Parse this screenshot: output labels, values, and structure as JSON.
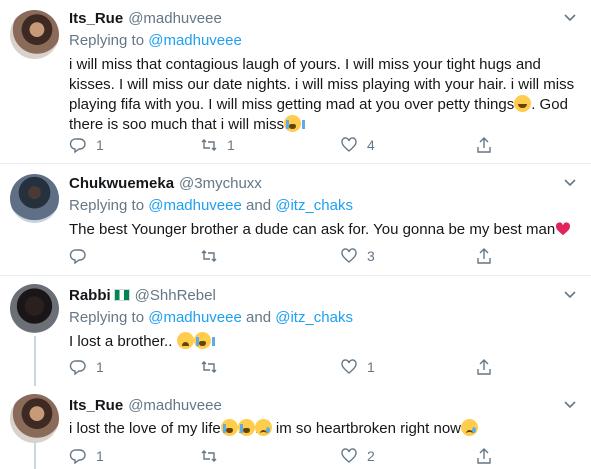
{
  "tweets": [
    {
      "name": "Its_Rue",
      "handle": "@madhuveee",
      "replying_label": "Replying to",
      "replying_mentions": "@madhuveee",
      "replying_and": "",
      "replying_second": "",
      "text_1": "i will miss that contagious laugh of yours. I will miss your tight hugs and kisses. I will miss our date nights. i will miss playing with your hair. i will miss playing fifa with you. I will miss getting mad at you over petty things",
      "text_2": ". God there is soo much that i will miss",
      "emojis": [
        "face-with-tears-of-joy",
        "loudly-crying-face"
      ],
      "reply_count": "1",
      "retweet_count": "1",
      "like_count": "4"
    },
    {
      "name": "Chukwuemeka",
      "handle": "@3mychuxx",
      "replying_label": "Replying to",
      "replying_mentions": "@madhuveee",
      "replying_and": "and",
      "replying_second": "@itz_chaks",
      "text_1": "The best Younger brother a dude can ask for. You gonna be my best man",
      "emojis": [
        "red-heart"
      ],
      "reply_count": "",
      "retweet_count": "",
      "like_count": "3"
    },
    {
      "name": "Rabbi",
      "handle": "@ShhRebel",
      "flag": "nigeria-flag",
      "replying_label": "Replying to",
      "replying_mentions": "@madhuveee",
      "replying_and": "and",
      "replying_second": "@itz_chaks",
      "text_1": "I lost a brother..",
      "emojis": [
        "weary-face",
        "loudly-crying-face"
      ],
      "reply_count": "1",
      "retweet_count": "",
      "like_count": "1"
    },
    {
      "name": "Its_Rue",
      "handle": "@madhuveee",
      "text_1": "i lost the love of my life",
      "text_2": " im so heartbroken right now",
      "emojis": [
        "loudly-crying-face",
        "loudly-crying-face",
        "crying-face",
        "crying-face"
      ],
      "reply_count": "1",
      "retweet_count": "",
      "like_count": "2"
    }
  ],
  "colors": {
    "accent": "#1da1f2",
    "secondary_text": "#657786",
    "divider": "#e6ecf0",
    "heart": "#e0245e"
  }
}
